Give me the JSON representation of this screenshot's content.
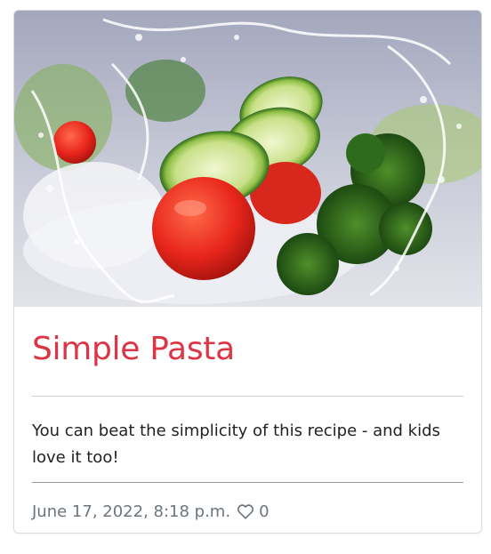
{
  "card": {
    "image_alt": "fresh vegetables with water splash",
    "title": "Simple Pasta",
    "description": "You can beat the simplicity of this recipe - and kids love it too!",
    "date": "June 17, 2022, 8:18 p.m.",
    "like_icon": "heart-icon",
    "likes": "0"
  },
  "colors": {
    "title": "#dc3545",
    "footer_text": "#6c757d"
  }
}
